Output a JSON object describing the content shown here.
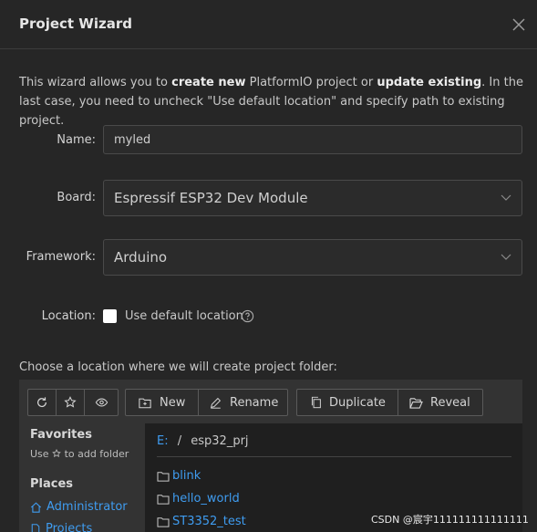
{
  "dialog": {
    "title": "Project Wizard"
  },
  "intro": {
    "p1": "This wizard allows you to ",
    "b1": "create new",
    "p2": " PlatformIO project or ",
    "b2": "update existing",
    "p3": ". In the last case, you need to uncheck \"Use default location\" and specify path to existing project."
  },
  "form": {
    "name_label": "Name:",
    "name_value": "myled",
    "board_label": "Board:",
    "board_value": "Espressif ESP32 Dev Module",
    "framework_label": "Framework:",
    "framework_value": "Arduino",
    "location_label": "Location:",
    "use_default_label": "Use default location",
    "use_default_checked": false
  },
  "browser": {
    "choose_text": "Choose a location where we will create project folder:",
    "toolbar": {
      "new": "New",
      "rename": "Rename",
      "duplicate": "Duplicate",
      "reveal": "Reveal"
    },
    "sidebar": {
      "favorites_title": "Favorites",
      "favorites_hint_pre": "Use",
      "favorites_hint_post": "to add folder",
      "places_title": "Places",
      "places": [
        "Administrator",
        "Projects"
      ]
    },
    "path": {
      "drive": "E:",
      "sep": "/",
      "folder": "esp32_prj"
    },
    "items": [
      "blink",
      "hello_world",
      "ST3352_test"
    ]
  },
  "watermark": "CSDN @宸宇111111111111111",
  "colors": {
    "background": "#262626",
    "link": "#3f9cf0",
    "panel": "#333333",
    "file_area": "#1f1f1f"
  }
}
